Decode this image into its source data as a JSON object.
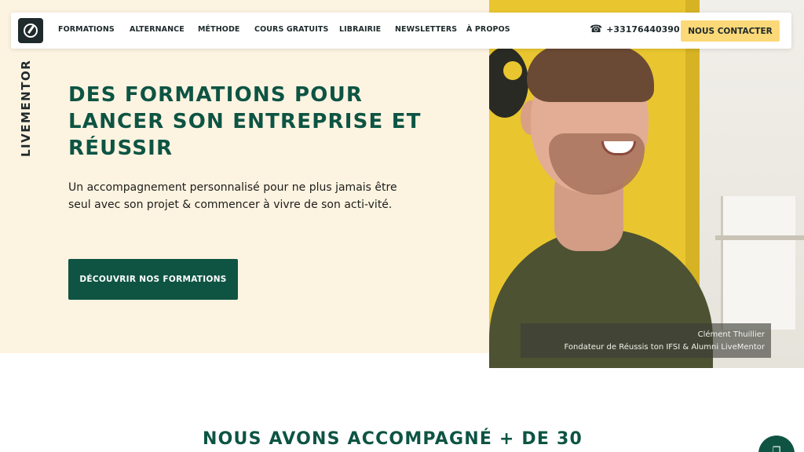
{
  "brand": {
    "name": "LIVEMENTOR"
  },
  "nav": {
    "items": [
      {
        "label": "FORMATIONS"
      },
      {
        "label": "ALTERNANCE"
      },
      {
        "label": "MÉTHODE"
      },
      {
        "label": "COURS GRATUITS"
      },
      {
        "label": "LIBRAIRIE"
      },
      {
        "label": "NEWSLETTERS"
      },
      {
        "label": "À PROPOS"
      }
    ],
    "phone": "+33176440390",
    "phone_icon": "phone-icon",
    "contact_label": "NOUS CONTACTER"
  },
  "hero": {
    "title": "DES FORMATIONS POUR LANCER SON ENTREPRISE ET RÉUSSIR",
    "subtitle": "Un accompagnement personnalisé pour ne plus jamais être seul avec son projet & commencer à vivre de son acti-vité.",
    "cta_label": "DÉCOUVRIR NOS FORMATIONS"
  },
  "testimonial": {
    "name": "Clément Thuillier",
    "role": "Fondateur de Réussis ton IFSI & Alumni LiveMentor"
  },
  "section": {
    "title": "NOUS AVONS ACCOMPAGNÉ + DE 30"
  },
  "colors": {
    "accent_green": "#0f5443",
    "accent_yellow": "#fcd978",
    "hero_background": "#fdf3e1"
  }
}
